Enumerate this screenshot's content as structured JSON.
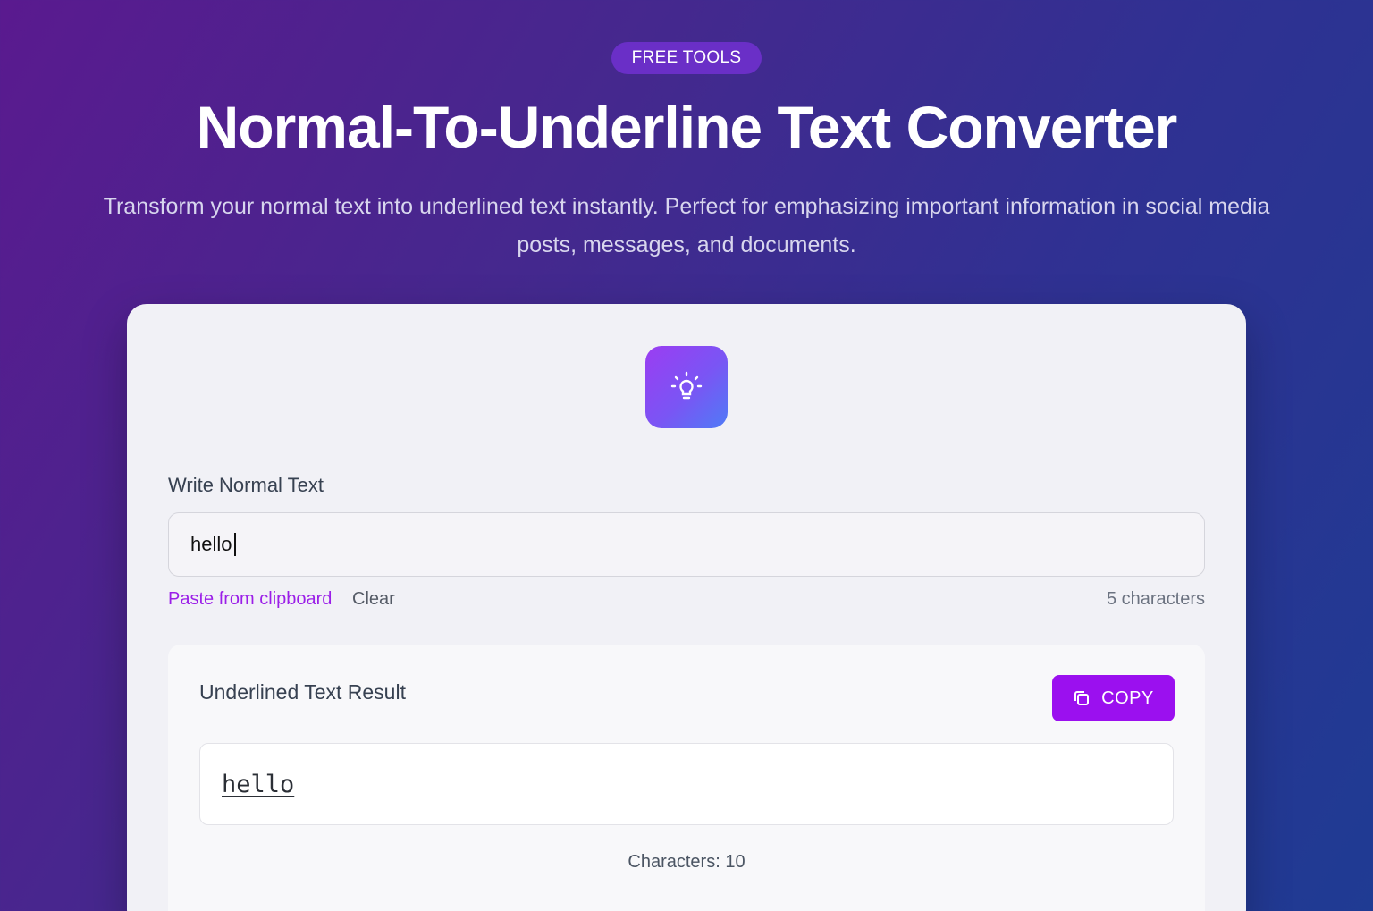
{
  "hero": {
    "badge": "FREE TOOLS",
    "title": "Normal-To-Underline Text Converter",
    "subtitle": "Transform your normal text into underlined text instantly. Perfect for emphasizing important information in social media posts, messages, and documents."
  },
  "card": {
    "icon": "lightbulb-icon",
    "input_label": "Write Normal Text",
    "input_value": "hello",
    "paste_label": "Paste from clipboard",
    "clear_label": "Clear",
    "char_count": "5 characters",
    "result": {
      "title": "Underlined Text Result",
      "copy_label": "COPY",
      "copy_icon": "copy-icon",
      "output": "hello",
      "count": "Characters: 10"
    }
  },
  "colors": {
    "accent": "#9b10ef",
    "link": "#9b1fe8",
    "badge_bg": "#6a2fc7"
  }
}
